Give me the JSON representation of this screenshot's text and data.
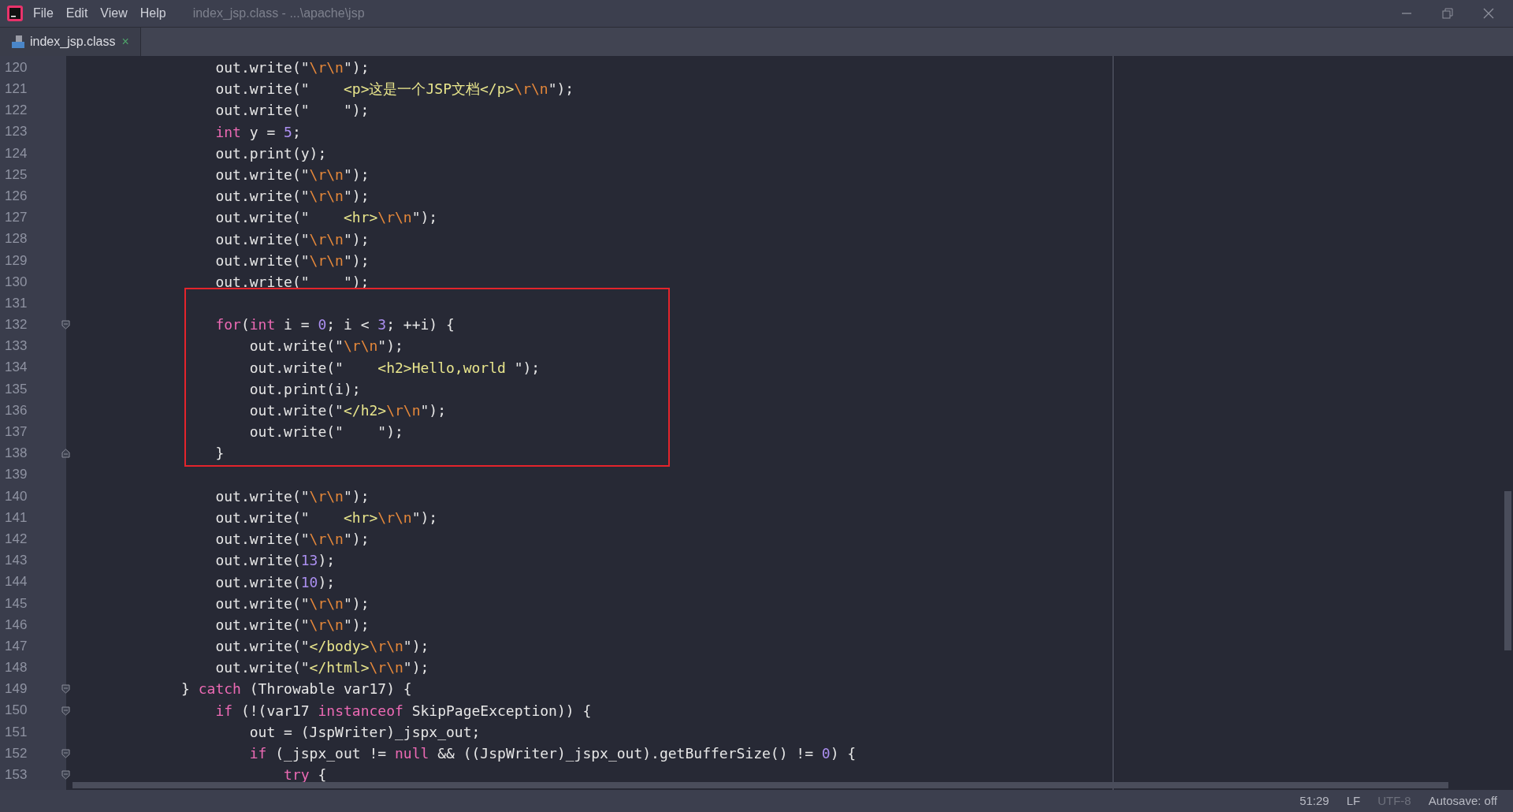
{
  "menu": [
    {
      "label": "File"
    },
    {
      "label": "Edit"
    },
    {
      "label": "View"
    },
    {
      "label": "Help"
    }
  ],
  "window": {
    "title": "index_jsp.class - ...\\apache\\jsp"
  },
  "tabs": [
    {
      "label": "index_jsp.class",
      "selected": true,
      "close": "×"
    }
  ],
  "code": {
    "blocks": [
      {
        "lines": [
          {
            "number": "120",
            "tokens": [
              {
                "kind": "plain",
                "text": "                out.write(\""
              },
              {
                "kind": "escape",
                "text": "\\r\\n"
              },
              {
                "kind": "plain",
                "text": "\");"
              }
            ]
          },
          {
            "number": "121",
            "tokens": [
              {
                "kind": "plain",
                "text": "                out.write(\"    "
              },
              {
                "kind": "string",
                "text": "<p>这是一个JSP文档</p>"
              },
              {
                "kind": "escape",
                "text": "\\r\\n"
              },
              {
                "kind": "plain",
                "text": "\");"
              }
            ]
          },
          {
            "number": "122",
            "tokens": [
              {
                "kind": "plain",
                "text": "                out.write(\"    \");"
              }
            ]
          },
          {
            "number": "123",
            "tokens": [
              {
                "kind": "keyword",
                "text": "                int"
              },
              {
                "kind": "plain",
                "text": " y = "
              },
              {
                "kind": "number",
                "text": "5"
              },
              {
                "kind": "plain",
                "text": ";"
              }
            ]
          },
          {
            "number": "124",
            "tokens": [
              {
                "kind": "plain",
                "text": "                out.print(y);"
              }
            ]
          },
          {
            "number": "125",
            "tokens": [
              {
                "kind": "plain",
                "text": "                out.write(\""
              },
              {
                "kind": "escape",
                "text": "\\r\\n"
              },
              {
                "kind": "plain",
                "text": "\");"
              }
            ]
          },
          {
            "number": "126",
            "tokens": [
              {
                "kind": "plain",
                "text": "                out.write(\""
              },
              {
                "kind": "escape",
                "text": "\\r\\n"
              },
              {
                "kind": "plain",
                "text": "\");"
              }
            ]
          },
          {
            "number": "127",
            "tokens": [
              {
                "kind": "plain",
                "text": "                out.write(\"    "
              },
              {
                "kind": "string",
                "text": "<hr>"
              },
              {
                "kind": "escape",
                "text": "\\r\\n"
              },
              {
                "kind": "plain",
                "text": "\");"
              }
            ]
          },
          {
            "number": "128",
            "tokens": [
              {
                "kind": "plain",
                "text": "                out.write(\""
              },
              {
                "kind": "escape",
                "text": "\\r\\n"
              },
              {
                "kind": "plain",
                "text": "\");"
              }
            ]
          },
          {
            "number": "129",
            "tokens": [
              {
                "kind": "plain",
                "text": "                out.write(\""
              },
              {
                "kind": "escape",
                "text": "\\r\\n"
              },
              {
                "kind": "plain",
                "text": "\");"
              }
            ]
          },
          {
            "number": "130",
            "tokens": [
              {
                "kind": "plain",
                "text": "                out.write(\"    \");"
              }
            ]
          }
        ]
      },
      {
        "highlighted": true,
        "lines": [
          {
            "number": "131"
          },
          {
            "number": "132",
            "fold": {
              "kind": "start"
            },
            "tokens": [
              {
                "kind": "keyword",
                "text": "                for"
              },
              {
                "kind": "plain",
                "text": "("
              },
              {
                "kind": "keyword",
                "text": "int"
              },
              {
                "kind": "plain",
                "text": " i = "
              },
              {
                "kind": "number",
                "text": "0"
              },
              {
                "kind": "plain",
                "text": "; i < "
              },
              {
                "kind": "number",
                "text": "3"
              },
              {
                "kind": "plain",
                "text": "; ++i) {"
              }
            ]
          },
          {
            "number": "133",
            "tokens": [
              {
                "kind": "plain",
                "text": "                    out.write(\""
              },
              {
                "kind": "escape",
                "text": "\\r\\n"
              },
              {
                "kind": "plain",
                "text": "\");"
              }
            ]
          },
          {
            "number": "134",
            "tokens": [
              {
                "kind": "plain",
                "text": "                    out.write(\"    "
              },
              {
                "kind": "string",
                "text": "<h2>Hello,world "
              },
              {
                "kind": "plain",
                "text": "\");"
              }
            ]
          },
          {
            "number": "135",
            "tokens": [
              {
                "kind": "plain",
                "text": "                    out.print(i);"
              }
            ]
          },
          {
            "number": "136",
            "tokens": [
              {
                "kind": "plain",
                "text": "                    out.write(\""
              },
              {
                "kind": "string",
                "text": "</h2>"
              },
              {
                "kind": "escape",
                "text": "\\r\\n"
              },
              {
                "kind": "plain",
                "text": "\");"
              }
            ]
          },
          {
            "number": "137",
            "tokens": [
              {
                "kind": "plain",
                "text": "                    out.write(\"    \");"
              }
            ]
          },
          {
            "number": "138",
            "fold": {
              "kind": "end"
            },
            "tokens": [
              {
                "kind": "plain",
                "text": "                }"
              }
            ]
          }
        ]
      },
      {
        "lines": [
          {
            "number": "139"
          },
          {
            "number": "140",
            "tokens": [
              {
                "kind": "plain",
                "text": "                out.write(\""
              },
              {
                "kind": "escape",
                "text": "\\r\\n"
              },
              {
                "kind": "plain",
                "text": "\");"
              }
            ]
          },
          {
            "number": "141",
            "tokens": [
              {
                "kind": "plain",
                "text": "                out.write(\"    "
              },
              {
                "kind": "string",
                "text": "<hr>"
              },
              {
                "kind": "escape",
                "text": "\\r\\n"
              },
              {
                "kind": "plain",
                "text": "\");"
              }
            ]
          },
          {
            "number": "142",
            "tokens": [
              {
                "kind": "plain",
                "text": "                out.write(\""
              },
              {
                "kind": "escape",
                "text": "\\r\\n"
              },
              {
                "kind": "plain",
                "text": "\");"
              }
            ]
          },
          {
            "number": "143",
            "tokens": [
              {
                "kind": "plain",
                "text": "                out.write("
              },
              {
                "kind": "number",
                "text": "13"
              },
              {
                "kind": "plain",
                "text": ");"
              }
            ]
          },
          {
            "number": "144",
            "tokens": [
              {
                "kind": "plain",
                "text": "                out.write("
              },
              {
                "kind": "number",
                "text": "10"
              },
              {
                "kind": "plain",
                "text": ");"
              }
            ]
          },
          {
            "number": "145",
            "tokens": [
              {
                "kind": "plain",
                "text": "                out.write(\""
              },
              {
                "kind": "escape",
                "text": "\\r\\n"
              },
              {
                "kind": "plain",
                "text": "\");"
              }
            ]
          },
          {
            "number": "146",
            "tokens": [
              {
                "kind": "plain",
                "text": "                out.write(\""
              },
              {
                "kind": "escape",
                "text": "\\r\\n"
              },
              {
                "kind": "plain",
                "text": "\");"
              }
            ]
          },
          {
            "number": "147",
            "tokens": [
              {
                "kind": "plain",
                "text": "                out.write(\""
              },
              {
                "kind": "string",
                "text": "</body>"
              },
              {
                "kind": "escape",
                "text": "\\r\\n"
              },
              {
                "kind": "plain",
                "text": "\");"
              }
            ]
          },
          {
            "number": "148",
            "tokens": [
              {
                "kind": "plain",
                "text": "                out.write(\""
              },
              {
                "kind": "string",
                "text": "</html>"
              },
              {
                "kind": "escape",
                "text": "\\r\\n"
              },
              {
                "kind": "plain",
                "text": "\");"
              }
            ]
          },
          {
            "number": "149",
            "fold": {
              "kind": "start"
            },
            "tokens": [
              {
                "kind": "plain",
                "text": "            } "
              },
              {
                "kind": "keyword",
                "text": "catch"
              },
              {
                "kind": "plain",
                "text": " (Throwable var17) {"
              }
            ]
          },
          {
            "number": "150",
            "fold": {
              "kind": "start"
            },
            "tokens": [
              {
                "kind": "keyword",
                "text": "                if"
              },
              {
                "kind": "plain",
                "text": " (!(var17 "
              },
              {
                "kind": "keyword",
                "text": "instanceof"
              },
              {
                "kind": "plain",
                "text": " SkipPageException)) {"
              }
            ]
          },
          {
            "number": "151",
            "tokens": [
              {
                "kind": "plain",
                "text": "                    out = (JspWriter)_jspx_out;"
              }
            ]
          },
          {
            "number": "152",
            "fold": {
              "kind": "start"
            },
            "tokens": [
              {
                "kind": "keyword",
                "text": "                    if"
              },
              {
                "kind": "plain",
                "text": " (_jspx_out != "
              },
              {
                "kind": "keyword",
                "text": "null"
              },
              {
                "kind": "plain",
                "text": " && ((JspWriter)_jspx_out).getBufferSize() != "
              },
              {
                "kind": "number",
                "text": "0"
              },
              {
                "kind": "plain",
                "text": ") {"
              }
            ]
          },
          {
            "number": "153",
            "fold": {
              "kind": "start"
            },
            "tokens": [
              {
                "kind": "keyword",
                "text": "                        try"
              },
              {
                "kind": "plain",
                "text": " {"
              }
            ]
          }
        ]
      }
    ]
  },
  "status_bar": [
    {
      "label": "51:29",
      "dim": false
    },
    {
      "label": "LF",
      "dim": false
    },
    {
      "label": "UTF-8",
      "dim": true
    },
    {
      "label": "Autosave: off",
      "dim": false
    }
  ]
}
